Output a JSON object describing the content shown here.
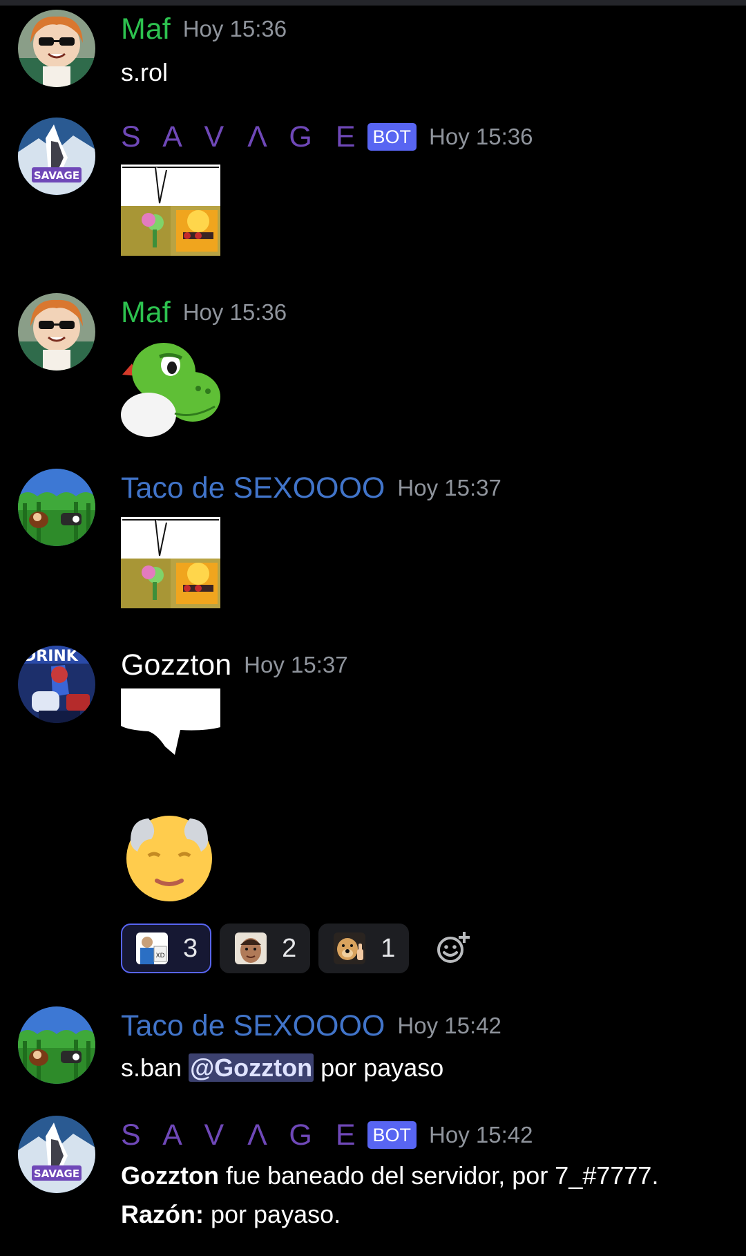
{
  "messages": [
    {
      "author": "Maf",
      "time": "Hoy 15:36",
      "avatar_icon": "anime-girl-sunglasses-avatar-icon",
      "content": "s.rol"
    },
    {
      "author": "S A V Λ G E",
      "bot_tag": "BOT",
      "time": "Hoy 15:36",
      "avatar_icon": "savage-wolf-avatar-icon",
      "sticker": "peashooter-meme-sticker"
    },
    {
      "author": "Maf",
      "time": "Hoy 15:36",
      "avatar_icon": "anime-girl-sunglasses-avatar-icon",
      "sticker": "yoshi-sticker"
    },
    {
      "author": "Taco de SEXOOOO",
      "time": "Hoy 15:37",
      "avatar_icon": "donkey-kong-avatar-icon",
      "sticker": "peashooter-meme-sticker"
    },
    {
      "author": "Gozzton",
      "time": "Hoy 15:37",
      "avatar_icon": "blue-hero-drink-avatar-icon",
      "sticker": "speech-bubble-sticker",
      "emoji": "older-man-emoji",
      "reactions": [
        {
          "icon": "xd-sign-man-emoji",
          "count": "3",
          "active": true
        },
        {
          "icon": "face-emoji",
          "count": "2",
          "active": false
        },
        {
          "icon": "thumbs-up-dog-emoji",
          "count": "1",
          "active": false
        }
      ],
      "add_reaction_icon": "add-reaction-icon"
    },
    {
      "author": "Taco de SEXOOOO",
      "time": "Hoy 15:42",
      "avatar_icon": "donkey-kong-avatar-icon",
      "content_parts": {
        "prefix": "s.ban ",
        "mention": "@Gozzton",
        "suffix": " por payaso"
      }
    },
    {
      "author": "S A V Λ G E",
      "bot_tag": "BOT",
      "time": "Hoy 15:42",
      "avatar_icon": "savage-wolf-avatar-icon",
      "line1": {
        "bold": "Gozzton",
        "rest": " fue baneado del servidor, por 7_#7777."
      },
      "line2": {
        "bold": "Razón:",
        "rest": " por payaso."
      }
    }
  ],
  "colors": {
    "background": "#000000",
    "maf_name": "#2dc24f",
    "savage_name": "#6f48b8",
    "taco_name": "#4174c9",
    "timestamp": "#8f949c",
    "bot_tag": "#5865f2",
    "mention_bg": "#3c416f"
  }
}
